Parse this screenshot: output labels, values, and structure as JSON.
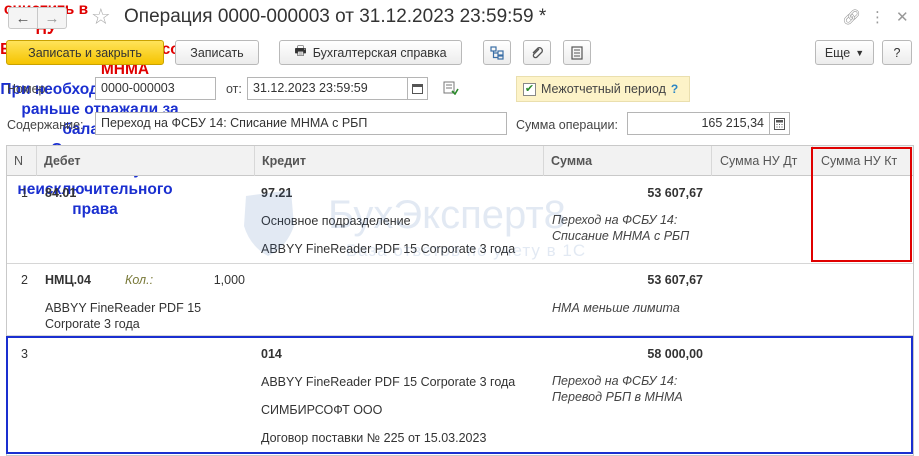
{
  "window": {
    "title": "Операция 0000-000003 от 31.12.2023 23:59:59 *"
  },
  "toolbar": {
    "save_close": "Записать и закрыть",
    "save": "Записать",
    "accounting_ref": "Бухгалтерская справка",
    "more": "Еще"
  },
  "form": {
    "number_label": "Номер:",
    "number_value": "0000-000003",
    "date_label": "от:",
    "date_value": "31.12.2023 23:59:59",
    "interim_label": "Межотчетный период",
    "interim_help": "?",
    "content_label": "Содержание:",
    "content_value": "Переход на ФСБУ 14: Списание МНМА с РБП",
    "sum_label": "Сумма операции:",
    "sum_value": "165 215,34"
  },
  "table": {
    "columns": [
      "N",
      "Дебет",
      "Кредит",
      "Сумма",
      "Сумма НУ Дт",
      "Сумма НУ Кт"
    ],
    "rows": [
      {
        "n": "1",
        "debit": "84.01",
        "credit": "97.21",
        "credit_sub1": "Основное подразделение",
        "credit_sub2": "ABBYY FineReader PDF 15 Corporate 3 года",
        "sum": "53 607,67",
        "comment1": "Переход на ФСБУ 14:",
        "comment2": "Списание МНМА с РБП"
      },
      {
        "n": "2",
        "debit": "НМЦ.04",
        "qty_label": "Кол.:",
        "qty_value": "1,000",
        "debit_sub1": "ABBYY FineReader PDF 15",
        "debit_sub2": "Corporate 3 года",
        "sum": "53 607,67",
        "comment1": "НМА меньше лимита"
      },
      {
        "n": "3",
        "credit": "014",
        "credit_sub1": "ABBYY FineReader PDF 15 Corporate 3 года",
        "credit_sub2": "СИМБИРСОФТ ООО",
        "credit_sub3": "Договор поставки № 225 от 15.03.2023",
        "sum": "58 000,00",
        "comment1": "Переход на ФСБУ 14:",
        "comment2": "Перевод РБП в МНМА"
      }
    ]
  },
  "annotations": {
    "clear_nu": "очистить в НУ",
    "offbalance_red": "Если ведете забалансовый учет МНМА",
    "if_needed": "При необходимости, если раньше отражали за балансом",
    "writeoff_blue": "Списание с забалансового учета неисключительного права"
  },
  "watermark": {
    "name": "БухЭксперт8",
    "tagline": "База ответов по учету в 1С"
  },
  "colors": {
    "primary_button": "#f5c400",
    "annotation_red": "#e00000",
    "annotation_blue": "#1a2fd0"
  }
}
